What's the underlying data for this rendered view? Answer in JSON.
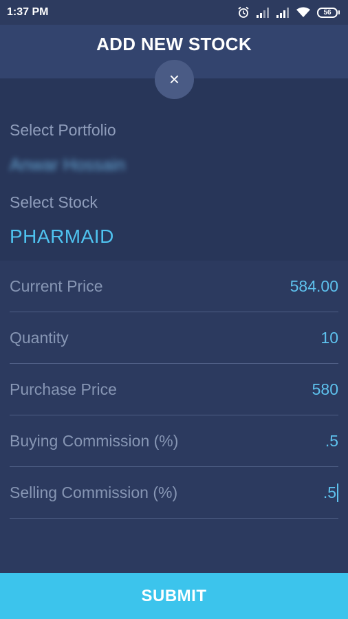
{
  "status_bar": {
    "time": "1:37 PM",
    "battery": "56",
    "icons": [
      "alarm-icon",
      "signal-icon",
      "signal-icon",
      "wifi-icon",
      "battery-icon"
    ]
  },
  "header": {
    "title": "ADD NEW STOCK",
    "close_icon": "×"
  },
  "selection": {
    "portfolio_label": "Select Portfolio",
    "portfolio_value": "Anwar Hossain",
    "stock_label": "Select Stock",
    "stock_value": "PHARMAID"
  },
  "form": {
    "fields": [
      {
        "label": "Current Price",
        "value": "584.00"
      },
      {
        "label": "Quantity",
        "value": "10"
      },
      {
        "label": "Purchase Price",
        "value": "580"
      },
      {
        "label": "Buying Commission (%)",
        "value": ".5"
      },
      {
        "label": "Selling Commission (%)",
        "value": ".5"
      }
    ]
  },
  "submit_label": "SUBMIT",
  "colors": {
    "background": "#2c3a5e",
    "header": "#33446e",
    "accent": "#3cc4ec",
    "value_text": "#5ec2ee"
  }
}
